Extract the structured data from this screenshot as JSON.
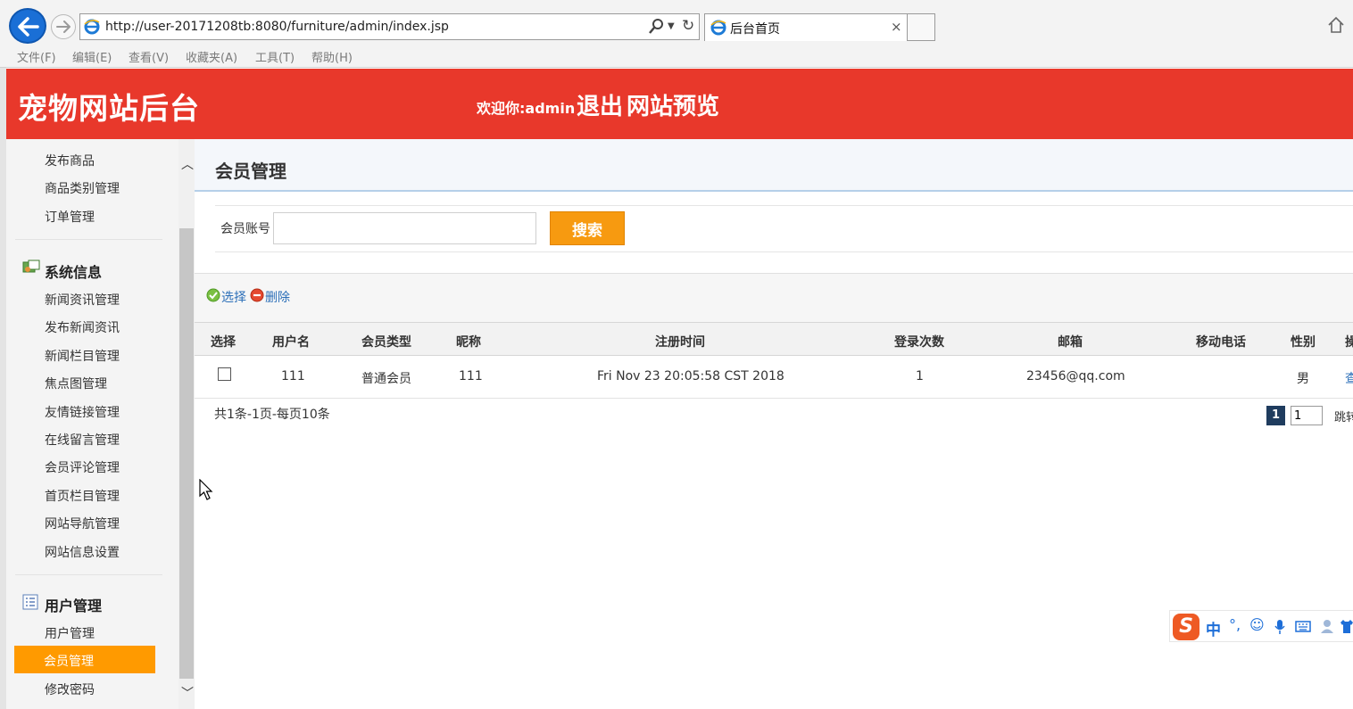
{
  "browser": {
    "url": "http://user-20171208tb:8080/furniture/admin/index.jsp",
    "tab_title": "后台首页",
    "tab_close": "×",
    "menu": [
      "文件(F)",
      "编辑(E)",
      "查看(V)",
      "收藏夹(A)",
      "工具(T)",
      "帮助(H)"
    ]
  },
  "header": {
    "site_title": "宠物网站后台",
    "welcome": "欢迎你:",
    "username": "admin",
    "logout": "退出",
    "preview": "网站预览",
    "color": "#e8382b"
  },
  "sidebar": {
    "goods_links": [
      "发布商品",
      "商品类别管理",
      "订单管理"
    ],
    "system_title": "系统信息",
    "system_links": [
      "新闻资讯管理",
      "发布新闻资讯",
      "新闻栏目管理",
      "焦点图管理",
      "友情链接管理",
      "在线留言管理",
      "会员评论管理",
      "首页栏目管理",
      "网站导航管理",
      "网站信息设置"
    ],
    "user_title": "用户管理",
    "user_links": [
      "用户管理",
      "会员管理",
      "修改密码"
    ],
    "active": "会员管理",
    "active_color": "#ff9a00"
  },
  "main": {
    "page_title": "会员管理",
    "search": {
      "label": "会员账号",
      "value": "",
      "button": "搜索"
    },
    "actions": {
      "select": "选择",
      "delete": "删除"
    },
    "table": {
      "columns": [
        "选择",
        "用户名",
        "会员类型",
        "昵称",
        "注册时间",
        "登录次数",
        "邮箱",
        "移动电话",
        "性别",
        "操"
      ],
      "rows": [
        {
          "username": "111",
          "member_type": "普通会员",
          "nickname": "111",
          "reg_time": "Fri Nov 23 20:05:58 CST 2018",
          "login_count": "1",
          "email": "23456@qq.com",
          "mobile": "",
          "gender": "男",
          "op": "查"
        }
      ]
    },
    "pager": {
      "summary": "共1条-1页-每页10条",
      "current": "1",
      "input": "1",
      "jump": "跳转"
    }
  },
  "ime": {
    "lang": "中",
    "punct": "°,"
  }
}
